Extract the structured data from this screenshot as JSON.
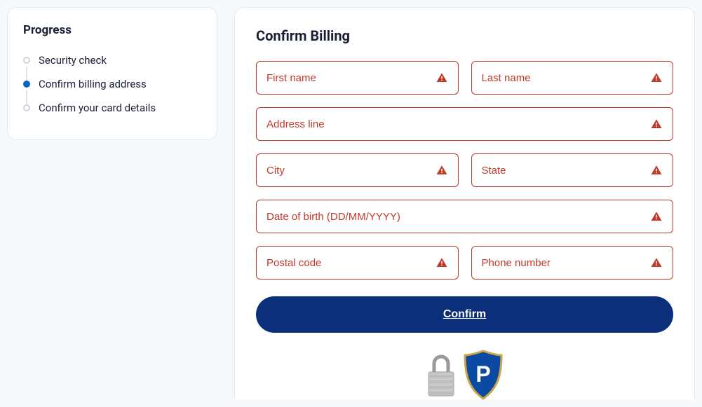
{
  "sidebar": {
    "title": "Progress",
    "steps": [
      {
        "label": "Security check",
        "active": false
      },
      {
        "label": "Confirm billing address",
        "active": true
      },
      {
        "label": "Confirm your card details",
        "active": false
      }
    ]
  },
  "form": {
    "title": "Confirm Billing",
    "confirm_label": "Confirm",
    "fields": {
      "first_name": {
        "placeholder": "First name",
        "value": ""
      },
      "last_name": {
        "placeholder": "Last name",
        "value": ""
      },
      "address": {
        "placeholder": "Address line",
        "value": ""
      },
      "city": {
        "placeholder": "City",
        "value": ""
      },
      "state": {
        "placeholder": "State",
        "value": ""
      },
      "dob": {
        "placeholder": "Date of birth (DD/MM/YYYY)",
        "value": ""
      },
      "postal_code": {
        "placeholder": "Postal code",
        "value": ""
      },
      "phone": {
        "placeholder": "Phone number",
        "value": ""
      }
    }
  },
  "trust": {
    "brand_letter": "P"
  }
}
